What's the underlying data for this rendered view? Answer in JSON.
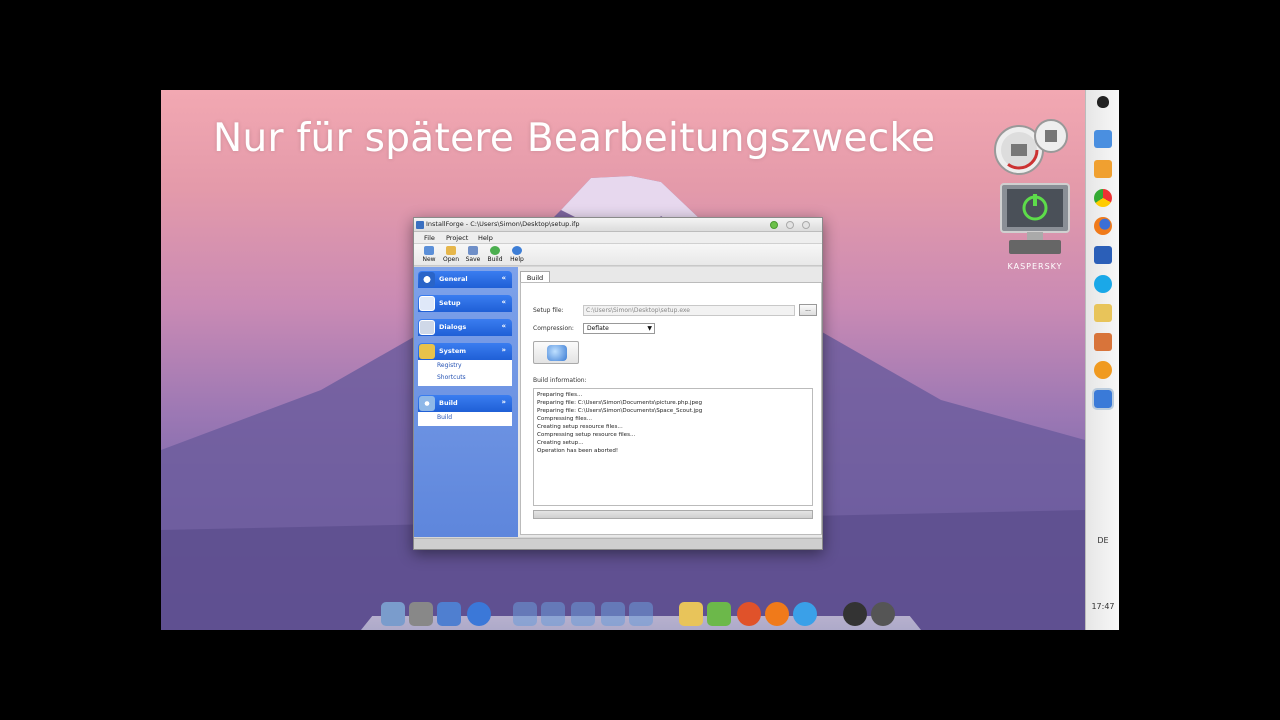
{
  "overlay_text": "Nur für spätere Bearbeitungszwecke",
  "desktop": {
    "kaspersky_label": "KASPERSKY",
    "language": "DE",
    "clock": "17:47",
    "dock_icons": [
      "finder-icon",
      "system-preferences-icon",
      "monitor-icon",
      "network-icon",
      "folder-icon",
      "folder-icon",
      "folder-icon",
      "folder-icon",
      "music-folder-icon",
      "mail-icon",
      "photo-icon",
      "filezilla-icon",
      "firefox-icon",
      "itunes-icon",
      "dashboard-icon",
      "trash-icon"
    ],
    "right_dock_icons": [
      "apple-icon",
      "finder-icon",
      "media-player-icon",
      "chrome-icon",
      "firefox-icon",
      "remote-desktop-icon",
      "skype-icon",
      "folder-icon",
      "game-icon",
      "headphones-icon",
      "build-app-icon"
    ]
  },
  "window": {
    "title": "InstallForge - C:\\Users\\Simon\\Desktop\\setup.ifp",
    "menu": [
      "File",
      "Project",
      "Help"
    ],
    "toolbar": [
      {
        "label": "New",
        "icon": "new-file-icon",
        "color": "#5b8fd8"
      },
      {
        "label": "Open",
        "icon": "open-folder-icon",
        "color": "#e6b64a"
      },
      {
        "label": "Save",
        "icon": "save-icon",
        "color": "#6f8fc8"
      },
      {
        "label": "Build",
        "icon": "build-icon",
        "color": "#4caf50"
      },
      {
        "label": "Help",
        "icon": "help-icon",
        "color": "#3d7ed6"
      }
    ],
    "sidebar": {
      "sections": [
        {
          "label": "General",
          "icon": "info-icon",
          "chevron": "«",
          "items": []
        },
        {
          "label": "Setup",
          "icon": "setup-window-icon",
          "chevron": "«",
          "items": []
        },
        {
          "label": "Dialogs",
          "icon": "dialogs-icon",
          "chevron": "«",
          "items": []
        },
        {
          "label": "System",
          "icon": "system-icon",
          "chevron": "»",
          "items": [
            "Registry",
            "Shortcuts"
          ]
        },
        {
          "label": "Build",
          "icon": "build-cd-icon",
          "chevron": "»",
          "items": [
            "Build"
          ]
        }
      ]
    },
    "tab": "Build",
    "setup_file_label": "Setup file:",
    "setup_file_value": "C:\\Users\\Simon\\Desktop\\setup.exe",
    "browse_label": "...",
    "compression_label": "Compression:",
    "compression_value": "Deflate",
    "build_info_label": "Build information:",
    "log_lines": [
      "Preparing files...",
      "Preparing file: C:\\Users\\Simon\\Documents\\picture.php.jpeg",
      "Preparing file: C:\\Users\\Simon\\Documents\\Space_Scout.jpg",
      "Compressing files...",
      "Creating setup resource files...",
      "Compressing setup resource files...",
      "Creating setup...",
      "Operation has been aborted!"
    ],
    "progress_fraction": 0
  }
}
